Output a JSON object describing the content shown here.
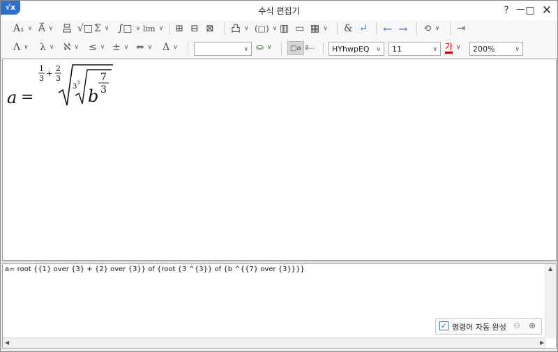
{
  "window": {
    "app_icon": "√x",
    "title": "수식 편집기"
  },
  "titlebar_buttons": {
    "help": "?",
    "minimize": "—",
    "maximize": "□",
    "close": "✕"
  },
  "toolbar_row1": [
    {
      "name": "format-style-tool",
      "label": "A₁"
    },
    {
      "name": "decoration-tool",
      "label": "A⃗"
    },
    {
      "name": "fraction-tool",
      "label": "吕"
    },
    {
      "name": "root-tool",
      "label": "√□"
    },
    {
      "name": "sum-tool",
      "label": "Σ"
    },
    {
      "name": "integral-tool",
      "label": "∫□"
    },
    {
      "name": "limit-tool",
      "label": "lim"
    },
    {
      "name": "matrix-tool-1",
      "label": "⊞"
    },
    {
      "name": "matrix-tool-2",
      "label": "⊟"
    },
    {
      "name": "matrix-tool-3",
      "label": "⊠"
    },
    {
      "name": "layout-tool",
      "label": "凸"
    },
    {
      "name": "bracket-tool",
      "label": "(□)"
    },
    {
      "name": "column-tool",
      "label": "▥"
    },
    {
      "name": "row-tool",
      "label": "▭"
    },
    {
      "name": "grid-tool",
      "label": "▦"
    },
    {
      "name": "ampersand-tool",
      "label": "&"
    },
    {
      "name": "newline-tool",
      "label": "↵"
    },
    {
      "name": "back-tool",
      "label": "←"
    },
    {
      "name": "forward-tool",
      "label": "→"
    },
    {
      "name": "convert-tool",
      "label": "⟲"
    },
    {
      "name": "insert-tool",
      "label": "⇥"
    }
  ],
  "toolbar_row2": [
    {
      "name": "greek-lower-tool",
      "label": "Λ"
    },
    {
      "name": "lambda-tool",
      "label": "λ"
    },
    {
      "name": "aleph-tool",
      "label": "ℵ"
    },
    {
      "name": "less-equal-tool",
      "label": "≤"
    },
    {
      "name": "plus-minus-tool",
      "label": "±"
    },
    {
      "name": "arrow-tool",
      "label": "⇔"
    },
    {
      "name": "delta-tool",
      "label": "Δ"
    }
  ],
  "combos": {
    "style": "",
    "font": "HYhwpEQ",
    "size": "11",
    "zoom": "200%"
  },
  "formula": {
    "lhs": "a",
    "eq": "=",
    "idx1_num": "1",
    "idx1_den": "3",
    "idx_plus": "+",
    "idx2_num": "2",
    "idx2_den": "3",
    "inner_index": "3",
    "inner_index_exp": "3",
    "base": "b",
    "exp_num": "7",
    "exp_den": "3"
  },
  "command": "a= root {{1} over {3} + {2} over {3}} of {root {3 ^{3}} of {b ^{{7} over {3}}}}",
  "autocomplete": {
    "checked": true,
    "label": "명령어 자동 완성"
  }
}
